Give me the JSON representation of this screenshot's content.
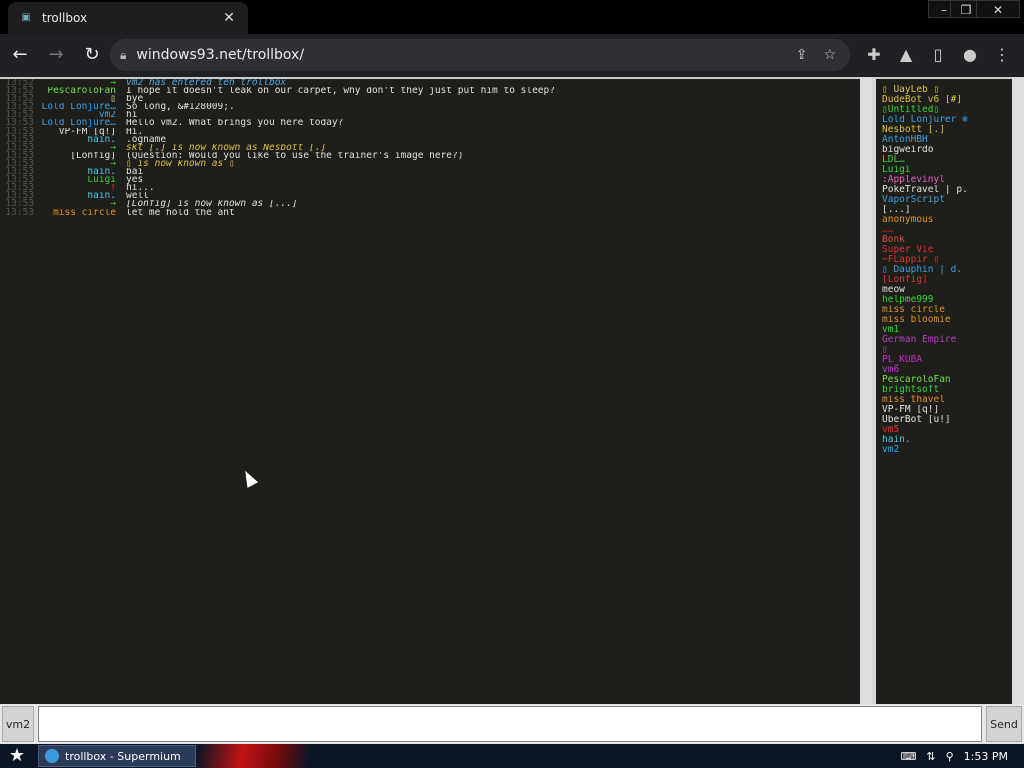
{
  "browser": {
    "tab_title": "trollbox",
    "url": "windows93.net/trollbox/",
    "close_label": "✕",
    "win_min": "–",
    "win_max": "❐",
    "win_close": "✕"
  },
  "chat": {
    "messages": [
      {
        "time": "13:52",
        "nick": "→",
        "nick_color": "#3bd23b",
        "text": "vm2 has entered teh trollbox",
        "italic": true,
        "text_color": "#4fa8e8"
      },
      {
        "time": "13:52",
        "nick": "PescaroloFan",
        "nick_color": "#6ee04b",
        "text": "I hope it doesn't leak on our carpet, why don't they just put him to sleep?",
        "italic": false
      },
      {
        "time": "13:52",
        "nick": "▯",
        "nick_color": "#e8e8a0",
        "text": "bye",
        "italic": false
      },
      {
        "time": "13:52",
        "nick": "Lold Lonjure…",
        "nick_color": "#3fa0e0",
        "text": "So long, &#128009;.",
        "italic": false
      },
      {
        "time": "13:52",
        "nick": "vm2",
        "nick_color": "#3fa0e0",
        "text": "hi",
        "italic": false
      },
      {
        "time": "13:53",
        "nick": "Lold Lonjure…",
        "nick_color": "#3fa0e0",
        "text": "Hello vm2. What brings you here today?",
        "italic": false
      },
      {
        "time": "13:53",
        "nick": "VP-FM [q!]",
        "nick_color": "#e0e0e0",
        "text": "Hi.",
        "italic": false
      },
      {
        "time": "13:53",
        "nick": "hain.",
        "nick_color": "#4fc8e8",
        "text": ".ogname",
        "italic": false
      },
      {
        "time": "13:53",
        "nick": "→",
        "nick_color": "#3bd23b",
        "text": "skt [.] is now known as Nesbott [.]",
        "italic": true,
        "text_color": "#e0c040"
      },
      {
        "time": "13:53",
        "nick": "[Lonfig]",
        "nick_color": "#e0e0e0",
        "text": "(Question: Would you like to use the trainer's image here?)",
        "italic": false
      },
      {
        "time": "13:53",
        "nick": "→",
        "nick_color": "#3bd23b",
        "text": "▯ is now known as ▯",
        "italic": true,
        "text_color": "#e0c040"
      },
      {
        "time": "13:53",
        "nick": "hain.",
        "nick_color": "#4fc8e8",
        "text": "bai",
        "italic": false
      },
      {
        "time": "13:53",
        "nick": "Luigi",
        "nick_color": "#3bd23b",
        "text": "yes",
        "italic": false
      },
      {
        "time": "13:53",
        "nick": "!",
        "nick_color": "#e03030",
        "text": "hi...",
        "italic": false
      },
      {
        "time": "13:53",
        "nick": "hain.",
        "nick_color": "#4fc8e8",
        "text": "well",
        "italic": false
      },
      {
        "time": "13:53",
        "nick": "→",
        "nick_color": "#3bd23b",
        "text": "[Lonfig] is now known as [...]",
        "italic": true,
        "text_color": "#e0e0e0"
      },
      {
        "time": "13:53",
        "nick": "miss circle",
        "nick_color": "#e8901e",
        "text": "let me hold the ant",
        "italic": false
      }
    ]
  },
  "users": [
    {
      "name": "▯ UayLeb ▯",
      "color": "#e0c040"
    },
    {
      "name": "DudeBot v6 [#]",
      "color": "#e0c040"
    },
    {
      "name": "▯Untitled▯",
      "color": "#3bd23b"
    },
    {
      "name": "Lold Lonjurer ❄",
      "color": "#3fa0e0"
    },
    {
      "name": "Nesbott [.]",
      "color": "#e0c040"
    },
    {
      "name": "AntonHBH",
      "color": "#3fa0e0"
    },
    {
      "name": "bigweirdo",
      "color": "#e0e0e0"
    },
    {
      "name": "LDL…",
      "color": "#3bd23b"
    },
    {
      "name": "Luigi",
      "color": "#3bd23b"
    },
    {
      "name": ":Applevinyl",
      "color": "#e060c0"
    },
    {
      "name": "PokeTravel | p.",
      "color": "#e0e0e0"
    },
    {
      "name": "VaporScript",
      "color": "#3fa0e0"
    },
    {
      "name": "[...]",
      "color": "#e0e0e0"
    },
    {
      "name": "anonymous",
      "color": "#e8901e"
    },
    {
      "name": "……",
      "color": "#b02020"
    },
    {
      "name": "Bonk",
      "color": "#e05030"
    },
    {
      "name": "Super Vie",
      "color": "#e03030"
    },
    {
      "name": "~FLappir ▯",
      "color": "#e03030"
    },
    {
      "name": "▯ Dauphin | d.",
      "color": "#3fa0e0"
    },
    {
      "name": "[Lonfig]",
      "color": "#e03030"
    },
    {
      "name": "meow",
      "color": "#e0e0e0"
    },
    {
      "name": "helpme999",
      "color": "#3bd23b"
    },
    {
      "name": "miss circle",
      "color": "#e8901e"
    },
    {
      "name": "miss bloomie",
      "color": "#e8901e"
    },
    {
      "name": "vm1",
      "color": "#3bd23b"
    },
    {
      "name": "German Empire",
      "color": "#b040c0"
    },
    {
      "name": "▯",
      "color": "#b040c0"
    },
    {
      "name": "PL_KUBA",
      "color": "#c030c0"
    },
    {
      "name": "vm6",
      "color": "#b040c0"
    },
    {
      "name": "PescaroloFan",
      "color": "#6ee04b"
    },
    {
      "name": "brightsoft",
      "color": "#3bd23b"
    },
    {
      "name": "miss thavel",
      "color": "#e8901e"
    },
    {
      "name": "VP-FM [q!]",
      "color": "#e0e0e0"
    },
    {
      "name": "UberBot [u!]",
      "color": "#e0e0e0"
    },
    {
      "name": "vm5",
      "color": "#e03030"
    },
    {
      "name": "hain.",
      "color": "#4fc8e8"
    },
    {
      "name": "vm2",
      "color": "#3fa0e0"
    }
  ],
  "input": {
    "nick_label": "vm2",
    "message_value": "",
    "send_label": "Send"
  },
  "taskbar": {
    "task_label": "trollbox - Supermium",
    "clock": "1:53 PM"
  }
}
